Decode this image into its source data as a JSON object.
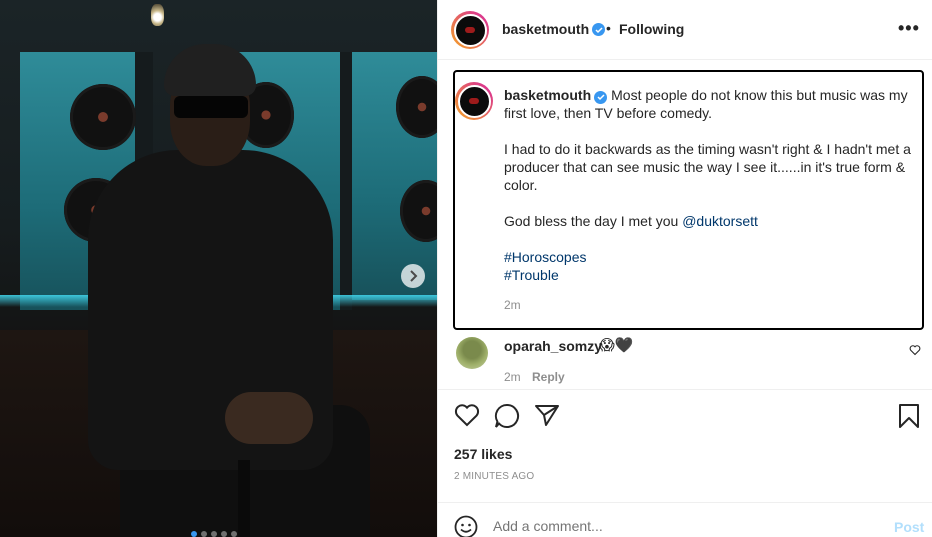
{
  "post": {
    "username": "basketmouth",
    "verified": true,
    "separator": "•",
    "follow_status": "Following",
    "more_label": "•••"
  },
  "caption": {
    "username": "basketmouth",
    "line1": "Most people do not know this but music was my first love, then TV before comedy.",
    "line2": "I had to do it backwards as the timing wasn't right & I hadn't met a producer that can see music the way I see it......in it's true form & color.",
    "line3_text": "God bless the day I met you ",
    "mention": "@duktorsett",
    "hashtag1": "#Horoscopes",
    "hashtag2": "#Trouble",
    "time": "2m"
  },
  "comment": {
    "username": "oparah_somzy",
    "emoji": "😱🖤",
    "time": "2m",
    "reply_label": "Reply"
  },
  "likes": "257 likes",
  "posted_ago": "2 MINUTES AGO",
  "add_comment": {
    "placeholder": "Add a comment...",
    "post_label": "Post"
  },
  "carousel": {
    "slides": 5,
    "current": 1
  },
  "colors": {
    "accent_blue": "#3897f0",
    "link_blue": "#00376b",
    "muted": "#8e8e8e",
    "post_disabled": "#b2dffc"
  },
  "icons": {
    "like": "heart-icon",
    "comment": "comment-bubble-icon",
    "share": "paper-plane-icon",
    "save": "bookmark-icon",
    "next": "chevron-right-icon",
    "emoji": "smiley-icon"
  }
}
